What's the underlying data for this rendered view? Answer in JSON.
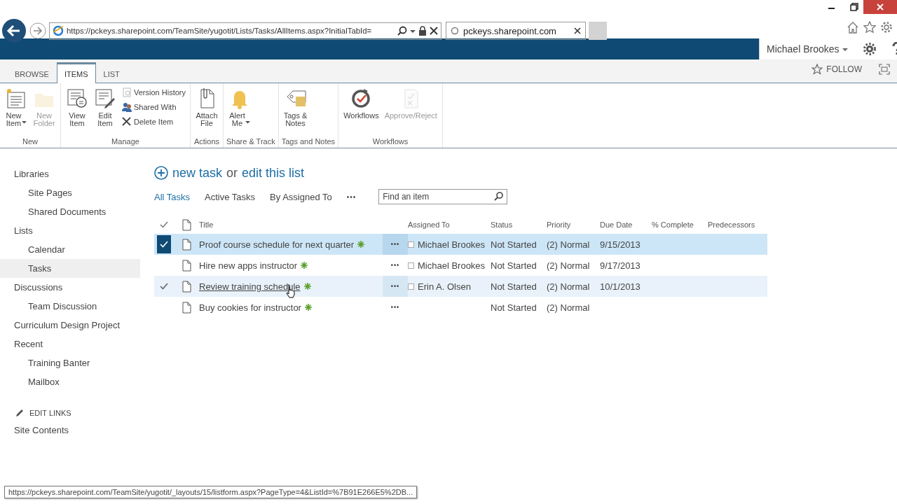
{
  "browser": {
    "url": "https://pckeys.sharepoint.com/TeamSite/yugotit/Lists/Tasks/AllItems.aspx?InitialTabId=",
    "tab": {
      "title": "pckeys.sharepoint.com"
    }
  },
  "suite_bar": {
    "user": "Michael Brookes"
  },
  "ribbon": {
    "tabs": [
      {
        "label": "BROWSE",
        "selected": false
      },
      {
        "label": "ITEMS",
        "selected": true
      },
      {
        "label": "LIST",
        "selected": false
      }
    ],
    "follow": "FOLLOW",
    "groups": [
      {
        "label": "New",
        "buttons": [
          {
            "label": "New\nItem",
            "kind": "large",
            "dropdown": true,
            "disabled": false
          },
          {
            "label": "New\nFolder",
            "kind": "large",
            "dropdown": false,
            "disabled": true
          }
        ]
      },
      {
        "label": "Manage",
        "buttons": [
          {
            "label": "View\nItem",
            "kind": "large",
            "dropdown": false,
            "disabled": false
          },
          {
            "label": "Edit\nItem",
            "kind": "large",
            "dropdown": false,
            "disabled": false
          },
          {
            "label": "Version History",
            "kind": "small",
            "dropdown": false,
            "disabled": false
          },
          {
            "label": "Shared With",
            "kind": "small",
            "dropdown": false,
            "disabled": false
          },
          {
            "label": "Delete Item",
            "kind": "small",
            "dropdown": false,
            "disabled": false
          }
        ]
      },
      {
        "label": "Actions",
        "buttons": [
          {
            "label": "Attach\nFile",
            "kind": "large",
            "dropdown": false,
            "disabled": false
          }
        ]
      },
      {
        "label": "Share & Track",
        "buttons": [
          {
            "label": "Alert\nMe",
            "kind": "large",
            "dropdown": true,
            "disabled": false
          }
        ]
      },
      {
        "label": "Tags and Notes",
        "buttons": [
          {
            "label": "Tags &\nNotes",
            "kind": "large",
            "dropdown": false,
            "disabled": false
          }
        ]
      },
      {
        "label": "Workflows",
        "buttons": [
          {
            "label": "Workflows",
            "kind": "large",
            "dropdown": false,
            "disabled": false
          },
          {
            "label": "Approve/Reject",
            "kind": "large",
            "dropdown": false,
            "disabled": true
          }
        ]
      }
    ]
  },
  "nav": {
    "sections": [
      {
        "label": "Libraries",
        "selected": false,
        "children": [
          {
            "label": "Site Pages",
            "selected": false
          },
          {
            "label": "Shared Documents",
            "selected": false
          }
        ]
      },
      {
        "label": "Lists",
        "selected": false,
        "children": [
          {
            "label": "Calendar",
            "selected": false
          },
          {
            "label": "Tasks",
            "selected": true
          }
        ]
      },
      {
        "label": "Discussions",
        "selected": false,
        "children": [
          {
            "label": "Team Discussion",
            "selected": false
          }
        ]
      },
      {
        "label": "Curriculum Design Project",
        "selected": false
      },
      {
        "label": "Recent",
        "selected": false,
        "children": [
          {
            "label": "Training Banter",
            "selected": false
          },
          {
            "label": "Mailbox",
            "selected": false
          }
        ]
      }
    ],
    "edit_links": "EDIT LINKS",
    "site_contents": "Site Contents"
  },
  "list": {
    "new_task": "new task",
    "or": "or",
    "edit_list": "edit this list",
    "views": [
      {
        "label": "All Tasks",
        "selected": true
      },
      {
        "label": "Active Tasks",
        "selected": false
      },
      {
        "label": "By Assigned To",
        "selected": false
      }
    ],
    "more": "•••",
    "search": {
      "placeholder": "Find an item"
    },
    "columns": [
      "Title",
      "Assigned To",
      "Status",
      "Priority",
      "Due Date",
      "% Complete",
      "Predecessors"
    ],
    "rows": [
      {
        "title": "Proof course schedule for next quarter",
        "assigned_to": "Michael Brookes",
        "status": "Not Started",
        "priority": "(2) Normal",
        "due_date": "9/15/2013",
        "selected": true,
        "hovered": false
      },
      {
        "title": "Hire new apps instructor",
        "assigned_to": "Michael Brookes",
        "status": "Not Started",
        "priority": "(2) Normal",
        "due_date": "9/17/2013",
        "selected": false,
        "hovered": false
      },
      {
        "title": "Review training schedule",
        "assigned_to": "Erin A. Olsen",
        "status": "Not Started",
        "priority": "(2) Normal",
        "due_date": "10/1/2013",
        "selected": false,
        "hovered": true
      },
      {
        "title": "Buy cookies for instructor",
        "status": "Not Started",
        "priority": "(2) Normal",
        "selected": false,
        "hovered": false
      }
    ],
    "row_menu": "•••"
  },
  "status_tip": "https://pckeys.sharepoint.com/TeamSite/yugotit/_layouts/15/listform.aspx?PageType=4&ListId=%7B91E266E5%2DB..."
}
